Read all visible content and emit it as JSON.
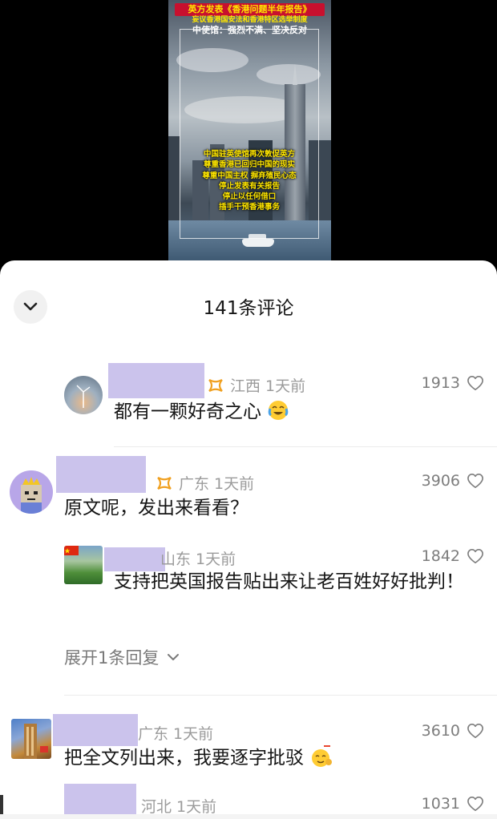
{
  "video": {
    "title_line1": "英方发表《香港问题半年报告》",
    "title_line2": "妄议香港国安法和香港特区选举制度",
    "title_line3": "中使馆：强烈不满、坚决反对",
    "caption_lines": [
      "中国驻英使馆再次敦促英方",
      "尊重香港已回归中国的现实",
      "尊重中国主权 摒弃殖民心态",
      "停止发表有关报告",
      "停止以任何借口",
      "插手干预香港事务"
    ]
  },
  "sheet": {
    "title": "141条评论",
    "collapse_icon": "chevron-down-icon"
  },
  "comments": [
    {
      "location_time": "江西 1天前",
      "likes": "1913",
      "text": "都有一颗好奇之心",
      "emoji": "crying-laughing-emoji-icon"
    },
    {
      "location_time": "广东 1天前",
      "likes": "3906",
      "text": "原文呢，发出来看看？",
      "reply": {
        "location_time": "山东 1天前",
        "likes": "1842",
        "text": "支持把英国报告贴出来让老百姓好好批判！"
      },
      "expand_label": "展开1条回复"
    },
    {
      "location_time": "广东 1天前",
      "likes": "3610",
      "text": "把全文列出来，我要逐字批驳",
      "emoji": "666-emoji-icon"
    },
    {
      "location_time": "河北 1天前",
      "likes": "1031"
    }
  ],
  "colors": {
    "name_redaction": "#cbc3ec",
    "badge": "#f0a020",
    "meta": "#9b9b9b"
  }
}
